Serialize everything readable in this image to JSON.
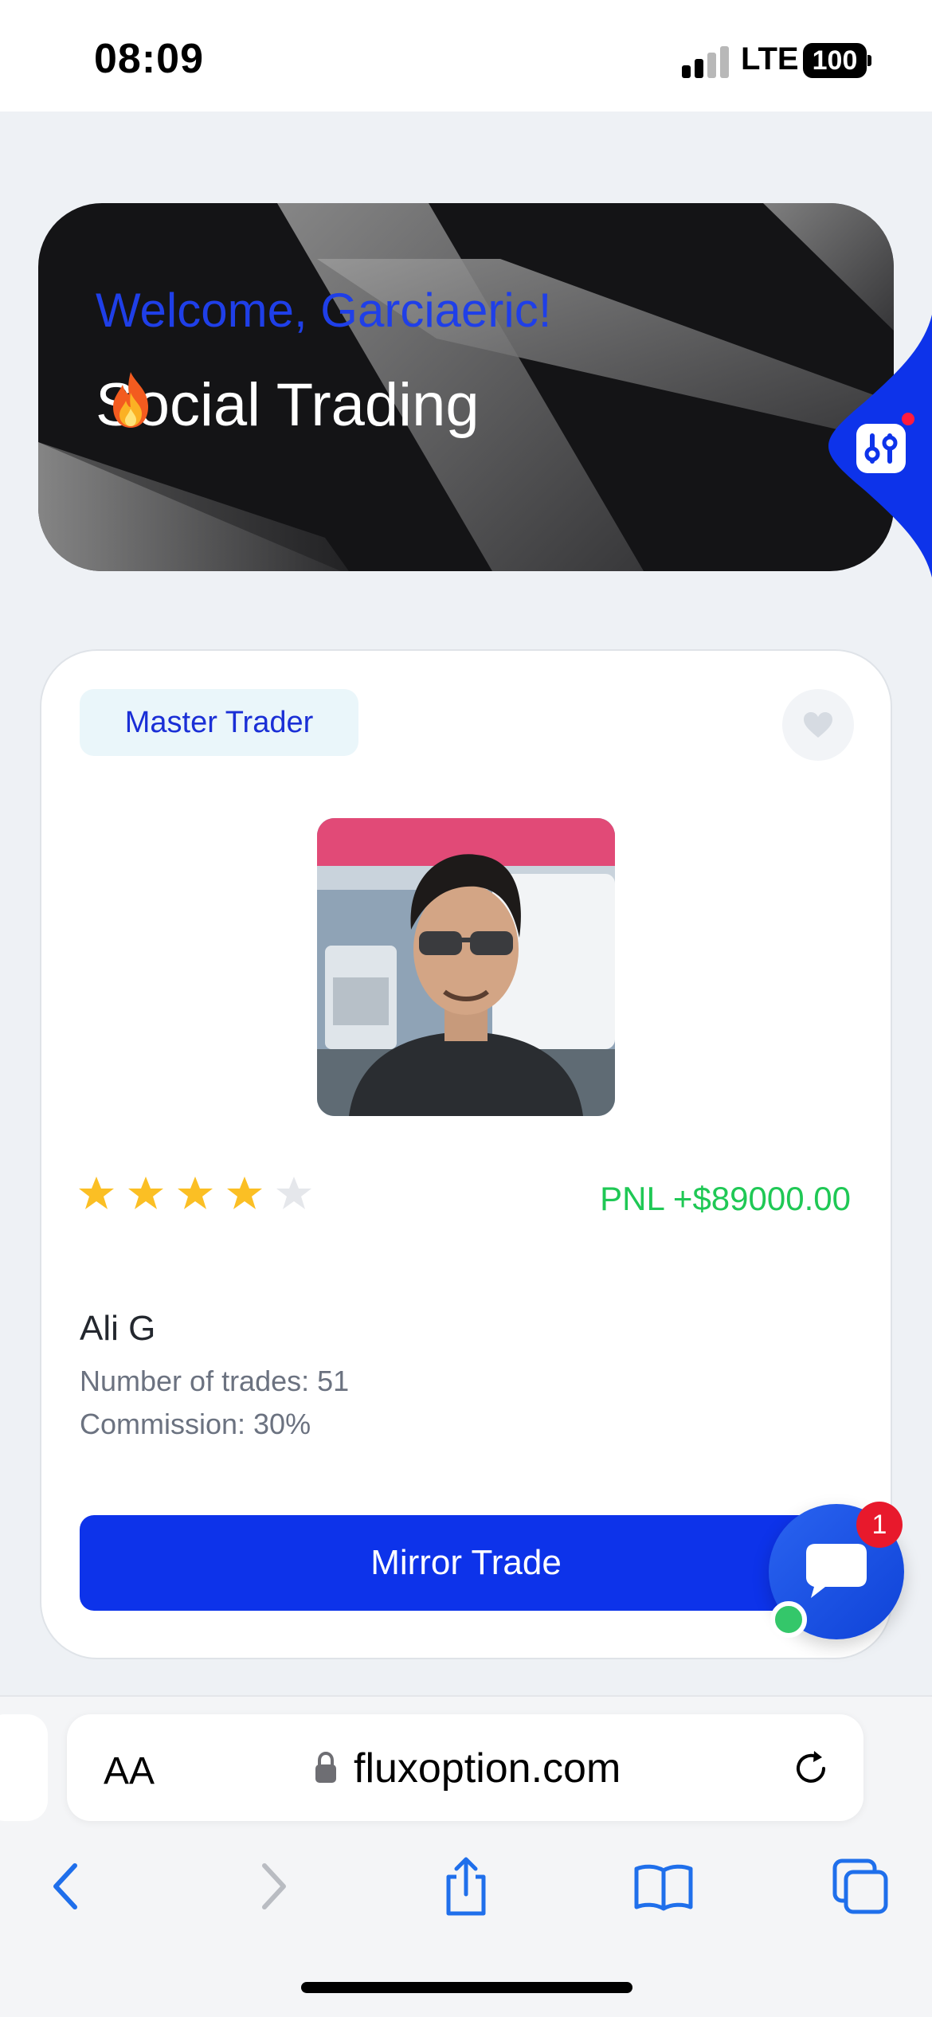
{
  "status_bar": {
    "time": "08:09",
    "network": "LTE",
    "battery": "100"
  },
  "hero": {
    "welcome": "Welcome, Garciaeric!",
    "title": "Social Trading",
    "title_icon": "fire-icon"
  },
  "trader_card": {
    "badge": "Master Trader",
    "favorite_icon": "heart-icon",
    "rating": 4,
    "rating_max": 5,
    "pnl": "PNL +$89000.00",
    "name": "Ali G",
    "trades": "Number of trades: 51",
    "commission": "Commission: 30%",
    "action": "Mirror Trade"
  },
  "chat": {
    "unread": "1",
    "icon": "chat-bubble-icon"
  },
  "browser": {
    "aa_label": "AA",
    "url": "fluxoption.com",
    "icons": [
      "back-icon",
      "forward-icon",
      "share-icon",
      "bookmarks-icon",
      "tabs-icon"
    ]
  },
  "colors": {
    "accent": "#0d33ea",
    "welcome": "#1f3fe8",
    "pnl": "#1fc855",
    "badge_bg": "#eaf6fa",
    "star": "#fbbf24",
    "star_empty": "#e5e7eb"
  }
}
